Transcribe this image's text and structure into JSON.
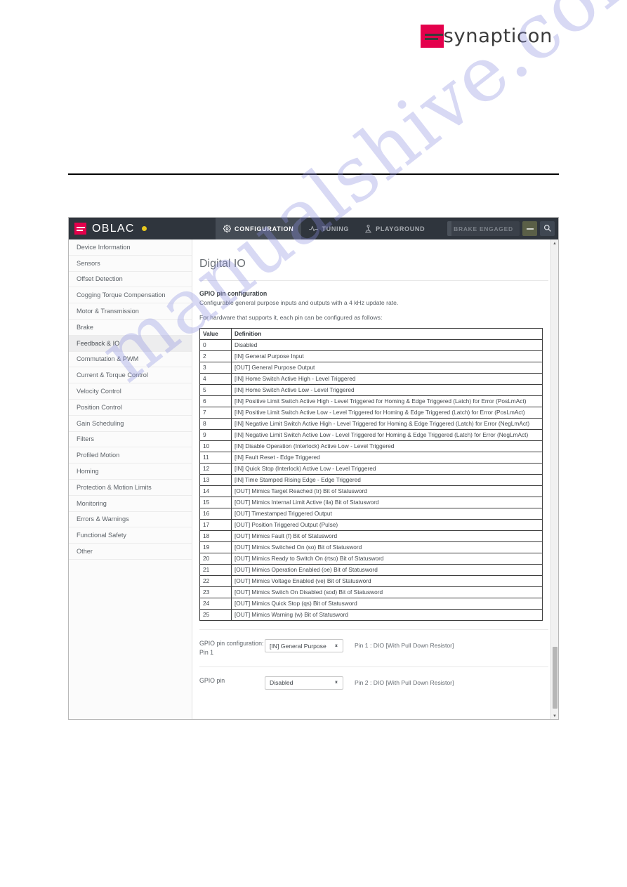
{
  "document": {
    "brand": "synapticon",
    "watermark": "manualshive.com"
  },
  "app": {
    "title": "OBLAC",
    "status_dot_color": "#e8c81e",
    "tabs": [
      {
        "label": "CONFIGURATION",
        "icon": "gear-icon",
        "active": true
      },
      {
        "label": "TUNING",
        "icon": "pulse-icon",
        "active": false
      },
      {
        "label": "PLAYGROUND",
        "icon": "joystick-icon",
        "active": false
      }
    ],
    "brake_status": "BRAKE ENGAGED",
    "menu_button": "menu-icon",
    "search_button": "search-icon"
  },
  "sidebar": {
    "items": [
      {
        "label": "Device Information",
        "active": false
      },
      {
        "label": "Sensors",
        "active": false
      },
      {
        "label": "Offset Detection",
        "active": false
      },
      {
        "label": "Cogging Torque Compensation",
        "active": false
      },
      {
        "label": "Motor & Transmission",
        "active": false
      },
      {
        "label": "Brake",
        "active": false
      },
      {
        "label": "Feedback & IO",
        "active": true
      },
      {
        "label": "Commutation & PWM",
        "active": false
      },
      {
        "label": "Current & Torque Control",
        "active": false
      },
      {
        "label": "Velocity Control",
        "active": false
      },
      {
        "label": "Position Control",
        "active": false
      },
      {
        "label": "Gain Scheduling",
        "active": false
      },
      {
        "label": "Filters",
        "active": false
      },
      {
        "label": "Profiled Motion",
        "active": false
      },
      {
        "label": "Homing",
        "active": false
      },
      {
        "label": "Protection & Motion Limits",
        "active": false
      },
      {
        "label": "Monitoring",
        "active": false
      },
      {
        "label": "Errors & Warnings",
        "active": false
      },
      {
        "label": "Functional Safety",
        "active": false
      },
      {
        "label": "Other",
        "active": false
      }
    ]
  },
  "main": {
    "title": "Digital IO",
    "section_heading": "GPIO pin configuration",
    "paragraph_1": "Configurable general purpose inputs and outputs with a 4 kHz update rate.",
    "paragraph_2": "For hardware that supports it, each pin can be configured as follows:",
    "table": {
      "columns": [
        "Value",
        "Definition"
      ],
      "rows": [
        {
          "value": "0",
          "definition": "Disabled"
        },
        {
          "value": "2",
          "definition": "[IN] General Purpose Input"
        },
        {
          "value": "3",
          "definition": "[OUT] General Purpose Output"
        },
        {
          "value": "4",
          "definition": "[IN] Home Switch Active High - Level Triggered"
        },
        {
          "value": "5",
          "definition": "[IN] Home Switch Active Low - Level Triggered"
        },
        {
          "value": "6",
          "definition": "[IN] Positive Limit Switch Active High - Level Triggered for Homing & Edge Triggered (Latch) for Error (PosLmAct)"
        },
        {
          "value": "7",
          "definition": "[IN] Positive Limit Switch Active Low - Level Triggered for Homing & Edge Triggered (Latch) for Error (PosLmAct)"
        },
        {
          "value": "8",
          "definition": "[IN] Negative Limit Switch Active High - Level Triggered for Homing & Edge Triggered (Latch) for Error (NegLmAct)"
        },
        {
          "value": "9",
          "definition": "[IN] Negative Limit Switch Active Low - Level Triggered for Homing & Edge Triggered (Latch) for Error (NegLmAct)"
        },
        {
          "value": "10",
          "definition": "[IN] Disable Operation (Interlock) Active Low - Level Triggered"
        },
        {
          "value": "11",
          "definition": "[IN] Fault Reset - Edge Triggered"
        },
        {
          "value": "12",
          "definition": "[IN] Quick Stop (Interlock) Active Low - Level Triggered"
        },
        {
          "value": "13",
          "definition": "[IN] Time Stamped Rising Edge - Edge Triggered"
        },
        {
          "value": "14",
          "definition": "[OUT] Mimics Target Reached (tr) Bit of Statusword"
        },
        {
          "value": "15",
          "definition": "[OUT] Mimics Internal Limit Active (ila) Bit of Statusword"
        },
        {
          "value": "16",
          "definition": "[OUT] Timestamped Triggered Output"
        },
        {
          "value": "17",
          "definition": "[OUT] Position Triggered Output (Pulse)"
        },
        {
          "value": "18",
          "definition": "[OUT] Mimics Fault (f) Bit of Statusword"
        },
        {
          "value": "19",
          "definition": "[OUT] Mimics Switched On (so) Bit of Statusword"
        },
        {
          "value": "20",
          "definition": "[OUT] Mimics Ready to Switch On (rtso) Bit of Statusword"
        },
        {
          "value": "21",
          "definition": "[OUT] Mimics Operation Enabled (oe) Bit of Statusword"
        },
        {
          "value": "22",
          "definition": "[OUT] Mimics Voltage Enabled (ve) Bit of Statusword"
        },
        {
          "value": "23",
          "definition": "[OUT] Mimics Switch On Disabled (sod) Bit of Statusword"
        },
        {
          "value": "24",
          "definition": "[OUT] Mimics Quick Stop (qs) Bit of Statusword"
        },
        {
          "value": "25",
          "definition": "[OUT] Mimics Warning (w) Bit of Statusword"
        }
      ]
    },
    "pin_rows": [
      {
        "label": "GPIO pin configuration: Pin 1",
        "selected": "[IN] General Purpose",
        "description": "Pin 1 : DIO [With Pull Down Resistor]"
      },
      {
        "label": "GPIO pin",
        "selected": "Disabled",
        "description": "Pin 2 : DIO [With Pull Down Resistor]"
      }
    ]
  }
}
